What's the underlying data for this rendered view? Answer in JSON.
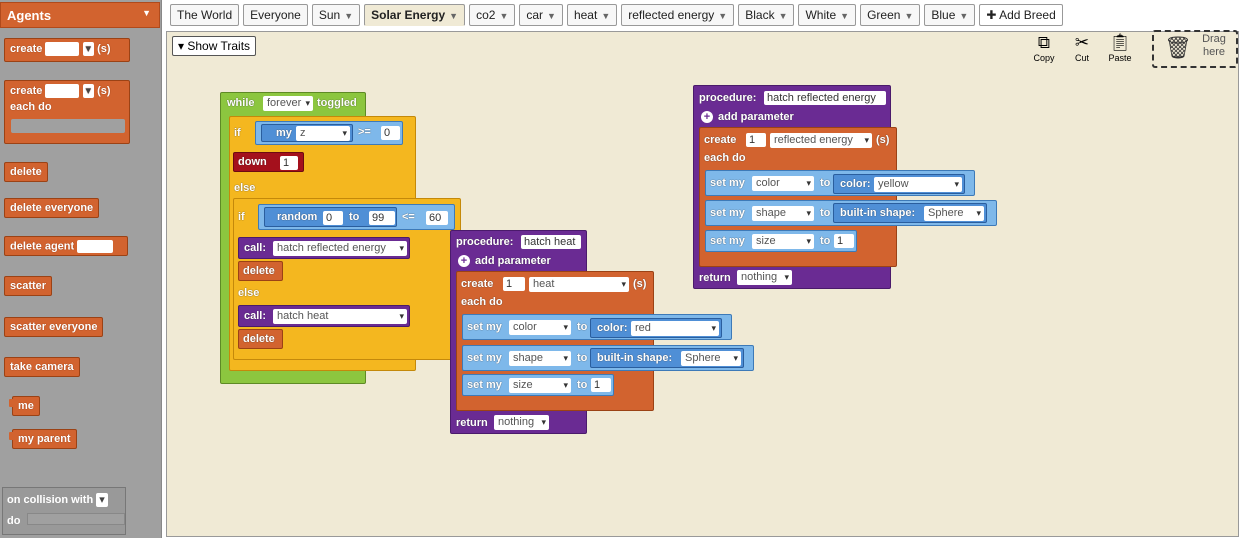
{
  "palette": {
    "header": "Agents",
    "blocks": {
      "create": "create",
      "create_suffix": "(s)",
      "create_each": "create",
      "create_each_suffix": "(s)",
      "each_do": "each do",
      "delete": "delete",
      "delete_everyone": "delete everyone",
      "delete_agent": "delete agent",
      "scatter": "scatter",
      "scatter_everyone": "scatter everyone",
      "take_camera": "take camera",
      "me": "me",
      "my_parent": "my parent",
      "on_collision_with": "on collision with",
      "do": "do"
    }
  },
  "tabs": [
    "The World",
    "Everyone",
    "Sun",
    "Solar Energy",
    "co2",
    "car",
    "heat",
    "reflected energy",
    "Black",
    "White",
    "Green",
    "Blue"
  ],
  "tabs_with_arrow": [
    false,
    false,
    true,
    true,
    true,
    true,
    true,
    true,
    true,
    true,
    true,
    true
  ],
  "active_tab": "Solar Energy",
  "add_breed": "Add Breed",
  "show_traits": "Show Traits",
  "tools": {
    "copy": "Copy",
    "cut": "Cut",
    "paste": "Paste"
  },
  "drag_here": "Drag here",
  "main_script": {
    "while": "while",
    "forever": "forever",
    "toggled": "toggled",
    "if1": "if",
    "my": "my",
    "z": "z",
    "gte": ">=",
    "zero": "0",
    "down": "down",
    "one": "1",
    "else1": "else",
    "if2": "if",
    "random": "random",
    "rand_from": "0",
    "to": "to",
    "rand_to": "99",
    "lte": "<=",
    "threshold": "60",
    "call1": "call:",
    "call1_target": "hatch reflected energy",
    "delete1": "delete",
    "else2": "else",
    "call2": "call:",
    "call2_target": "hatch heat",
    "delete2": "delete"
  },
  "proc_heat": {
    "procedure": "procedure:",
    "name": "hatch heat",
    "add_parameter": "add parameter",
    "create": "create",
    "count": "1",
    "breed": "heat",
    "suffix": "(s)",
    "each_do": "each do",
    "set_my": "set my",
    "trait1": "color",
    "to": "to",
    "color_label": "color:",
    "color_value": "red",
    "trait2": "shape",
    "shape_label": "built-in shape:",
    "shape_value": "Sphere",
    "trait3": "size",
    "size_value": "1",
    "return": "return",
    "return_value": "nothing"
  },
  "proc_reflected": {
    "procedure": "procedure:",
    "name": "hatch reflected energy",
    "add_parameter": "add parameter",
    "create": "create",
    "count": "1",
    "breed": "reflected energy",
    "suffix": "(s)",
    "each_do": "each do",
    "set_my": "set my",
    "trait1": "color",
    "to": "to",
    "color_label": "color:",
    "color_value": "yellow",
    "trait2": "shape",
    "shape_label": "built-in shape:",
    "shape_value": "Sphere",
    "trait3": "size",
    "size_value": "1",
    "return": "return",
    "return_value": "nothing"
  }
}
